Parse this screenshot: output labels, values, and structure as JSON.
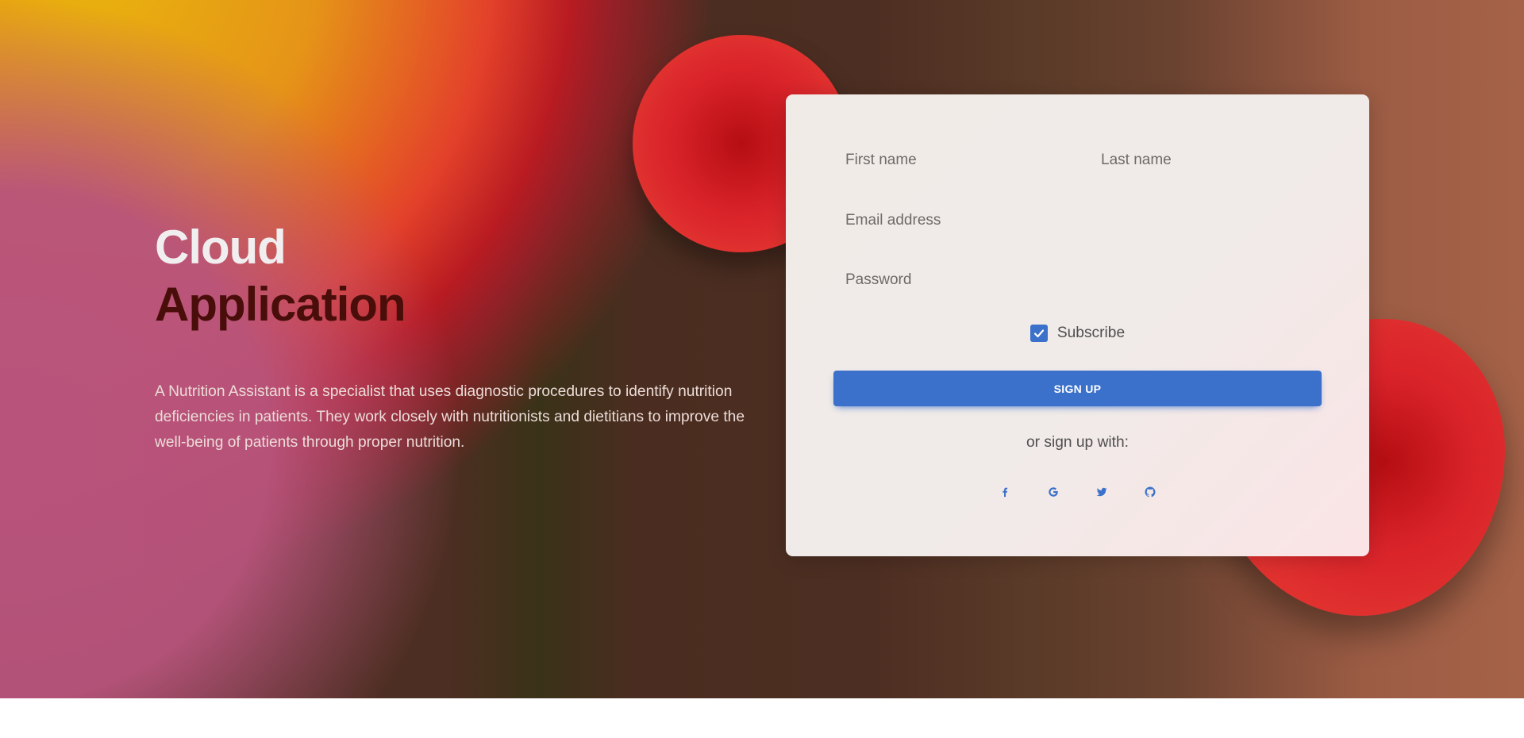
{
  "hero": {
    "title_line1": "Cloud",
    "title_line2": "Application",
    "description": "A Nutrition Assistant is a specialist that uses diagnostic procedures to identify nutrition deficiencies in patients. They work closely with nutritionists and dietitians to improve the well-being of patients through proper nutrition."
  },
  "form": {
    "first_name_placeholder": "First name",
    "last_name_placeholder": "Last name",
    "email_placeholder": "Email address",
    "password_placeholder": "Password",
    "subscribe_label": "Subscribe",
    "subscribe_checked": true,
    "signup_label": "SIGN UP",
    "alt_signup_text": "or sign up with:",
    "socials": [
      {
        "name": "facebook-icon"
      },
      {
        "name": "google-icon"
      },
      {
        "name": "twitter-icon"
      },
      {
        "name": "github-icon"
      }
    ]
  },
  "colors": {
    "primary": "#3b71ca",
    "title_light": "#f1eef0",
    "title_dark": "#4a0e0a",
    "blob_red": "#d9232a"
  }
}
